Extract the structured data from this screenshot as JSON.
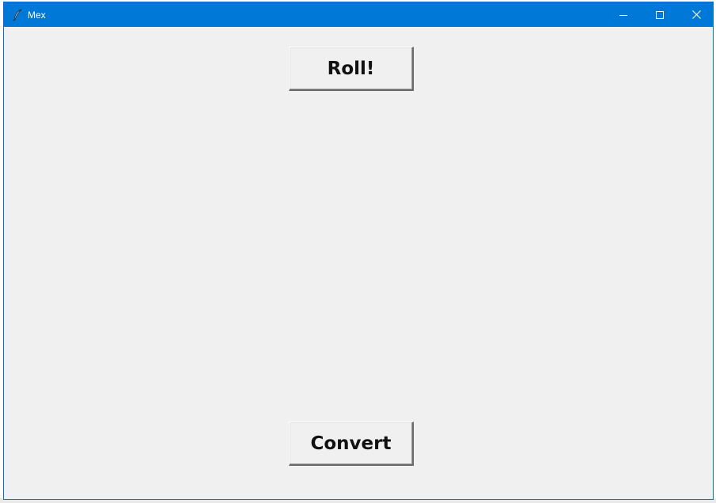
{
  "window": {
    "title": "Mex",
    "icon": "feather-icon",
    "accent_color": "#0078d7",
    "controls": {
      "minimize": "minimize-icon",
      "maximize": "maximize-icon",
      "close": "close-icon"
    }
  },
  "main": {
    "roll_label": "Roll!",
    "convert_label": "Convert"
  }
}
